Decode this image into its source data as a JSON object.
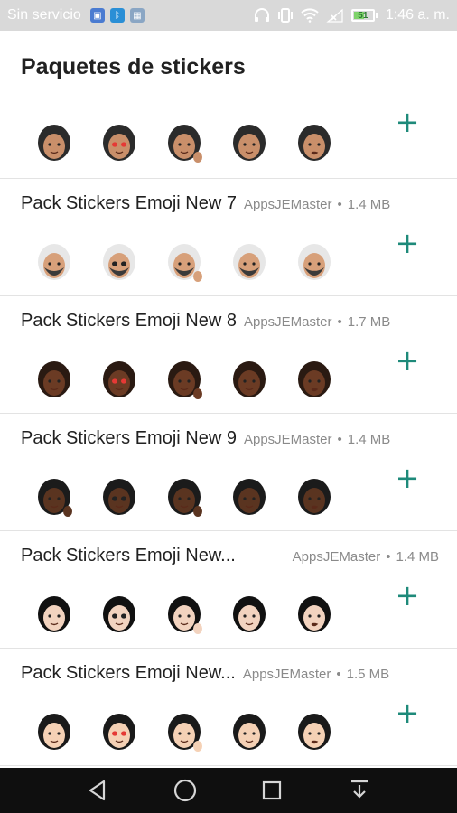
{
  "status_bar": {
    "carrier": "Sin servicio",
    "battery_level": "51",
    "time": "1:46 a. m.",
    "icons": [
      "sim-icon",
      "bluetooth-icon",
      "image-icon",
      "headphones-icon",
      "vibrate-icon",
      "wifi-icon",
      "no-signal-icon",
      "battery-icon"
    ]
  },
  "header": {
    "title": "Paquetes de stickers"
  },
  "packs": [
    {
      "name": "",
      "publisher": "",
      "size": "",
      "palette": {
        "skin": "#c98f6a",
        "hair": "#2b2b2b",
        "accent": "#6b6b6b"
      }
    },
    {
      "name": "Pack Stickers Emoji New 7",
      "publisher": "AppsJEMaster",
      "size": "1.4 MB",
      "palette": {
        "skin": "#d7a07a",
        "hair": "#3a3a3a",
        "accent": "#e7e7e7"
      }
    },
    {
      "name": "Pack Stickers Emoji New 8",
      "publisher": "AppsJEMaster",
      "size": "1.7 MB",
      "palette": {
        "skin": "#6b3b24",
        "hair": "#2a1a12",
        "accent": "#e53935"
      }
    },
    {
      "name": "Pack Stickers Emoji New 9",
      "publisher": "AppsJEMaster",
      "size": "1.4 MB",
      "palette": {
        "skin": "#5a3420",
        "hair": "#1b1b1b",
        "accent": "#9e9e9e"
      }
    },
    {
      "name": "Pack Stickers Emoji New...",
      "publisher": "AppsJEMaster",
      "size": "1.4 MB",
      "palette": {
        "skin": "#f2d3bf",
        "hair": "#111111",
        "accent": "#5c6bc0"
      }
    },
    {
      "name": "Pack Stickers Emoji New...",
      "publisher": "AppsJEMaster",
      "size": "1.5 MB",
      "palette": {
        "skin": "#f5d1b5",
        "hair": "#1a1a1a",
        "accent": "#e53935"
      }
    }
  ],
  "separator": "•",
  "add_symbol": "+",
  "colors": {
    "accent": "#1e8a7a",
    "status_bar": "#d9d9d9",
    "nav_bar": "#0f0f0f"
  },
  "navigation": [
    "back-icon",
    "home-icon",
    "recents-icon",
    "notifications-pull-icon"
  ]
}
